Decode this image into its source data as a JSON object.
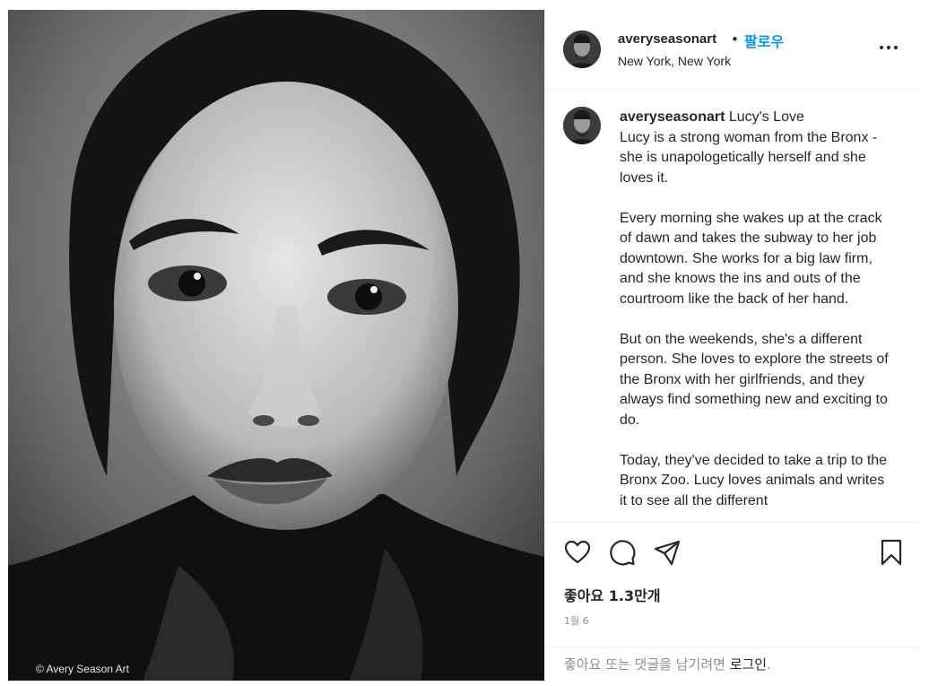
{
  "post": {
    "watermark": "© Avery Season Art",
    "username": "averyseasonart",
    "separator": "•",
    "follow_label": "팔로우",
    "location": "New York, New York",
    "caption_title": "Lucy's Love",
    "caption_body": "Lucy is a strong woman from the Bronx - she is unapologetically herself and she loves it.\n\nEvery morning she wakes up at the crack of dawn and takes the subway to her job downtown. She works for a big law firm, and she knows the ins and outs of the courtroom like the back of her hand.\n\nBut on the weekends, she's a different person. She loves to explore the streets of the Bronx with her girlfriends, and they always find something new and exciting to do.\n\nToday, they've decided to take a trip to the Bronx Zoo. Lucy loves animals and writes it to see all the different",
    "likes_label": "좋아요",
    "likes_count": "1.3만개",
    "date": "1월 6",
    "login_prompt": "좋아요 또는 댓글을 남기려면",
    "login_link": "로그인",
    "login_suffix": "."
  },
  "icons": [
    "more-options-icon",
    "heart-icon",
    "comment-icon",
    "share-icon",
    "bookmark-icon"
  ],
  "colors": {
    "accent": "#0095f6",
    "text": "#262626",
    "muted": "#8e8e8e",
    "border": "#efefef"
  }
}
